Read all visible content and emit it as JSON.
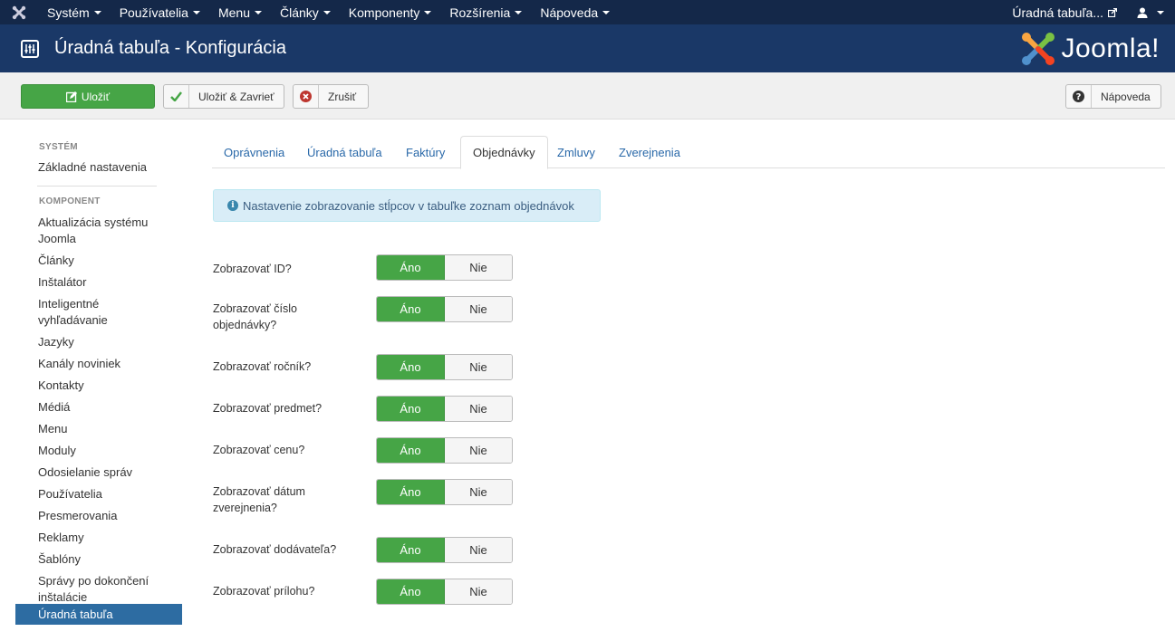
{
  "topnav": {
    "menu": [
      {
        "label": "Systém"
      },
      {
        "label": "Používatelia"
      },
      {
        "label": "Menu"
      },
      {
        "label": "Články"
      },
      {
        "label": "Komponenty"
      },
      {
        "label": "Rozšírenia"
      },
      {
        "label": "Nápoveda"
      }
    ],
    "site_link": "Úradná tabuľa..."
  },
  "header": {
    "title": "Úradná tabuľa - Konfigurácia",
    "brand": "Joomla!"
  },
  "toolbar": {
    "save_label": "Uložiť",
    "save_close_label": "Uložiť & Zavrieť",
    "cancel_label": "Zrušiť",
    "help_label": "Nápoveda"
  },
  "sidebar": {
    "system_heading": "SYSTÉM",
    "system_items": [
      "Základné nastavenia"
    ],
    "component_heading": "KOMPONENT",
    "component_items": [
      "Aktualizácia systému Joomla",
      "Články",
      "Inštalátor",
      "Inteligentné vyhľadávanie",
      "Jazyky",
      "Kanály noviniek",
      "Kontakty",
      "Médiá",
      "Menu",
      "Moduly",
      "Odosielanie správ",
      "Používatelia",
      "Presmerovania",
      "Reklamy",
      "Šablóny",
      "Správy po dokončení inštalácie",
      "Úradná tabuľa"
    ]
  },
  "tabs": [
    {
      "label": "Oprávnenia"
    },
    {
      "label": "Úradná tabuľa"
    },
    {
      "label": "Faktúry"
    },
    {
      "label": "Objednávky"
    },
    {
      "label": "Zmluvy"
    },
    {
      "label": "Zverejnenia"
    }
  ],
  "alert": {
    "text": "Nastavenie zobrazovanie stĺpcov v tabuľke zoznam objednávok"
  },
  "fields": [
    {
      "label": "Zobrazovať ID?",
      "yes": "Áno",
      "no": "Nie",
      "value": "Áno"
    },
    {
      "label": "Zobrazovať číslo objednávky?",
      "yes": "Áno",
      "no": "Nie",
      "value": "Áno"
    },
    {
      "label": "Zobrazovať ročník?",
      "yes": "Áno",
      "no": "Nie",
      "value": "Áno"
    },
    {
      "label": "Zobrazovať predmet?",
      "yes": "Áno",
      "no": "Nie",
      "value": "Áno"
    },
    {
      "label": "Zobrazovať cenu?",
      "yes": "Áno",
      "no": "Nie",
      "value": "Áno"
    },
    {
      "label": "Zobrazovať dátum zverejnenia?",
      "yes": "Áno",
      "no": "Nie",
      "value": "Áno"
    },
    {
      "label": "Zobrazovať dodávateľa?",
      "yes": "Áno",
      "no": "Nie",
      "value": "Áno"
    },
    {
      "label": "Zobrazovať prílohu?",
      "yes": "Áno",
      "no": "Nie",
      "value": "Áno"
    }
  ],
  "colors": {
    "topnav": "#142849",
    "header": "#1a3867",
    "success": "#46a546",
    "link": "#2a69a9",
    "active": "#2d6ca2"
  }
}
